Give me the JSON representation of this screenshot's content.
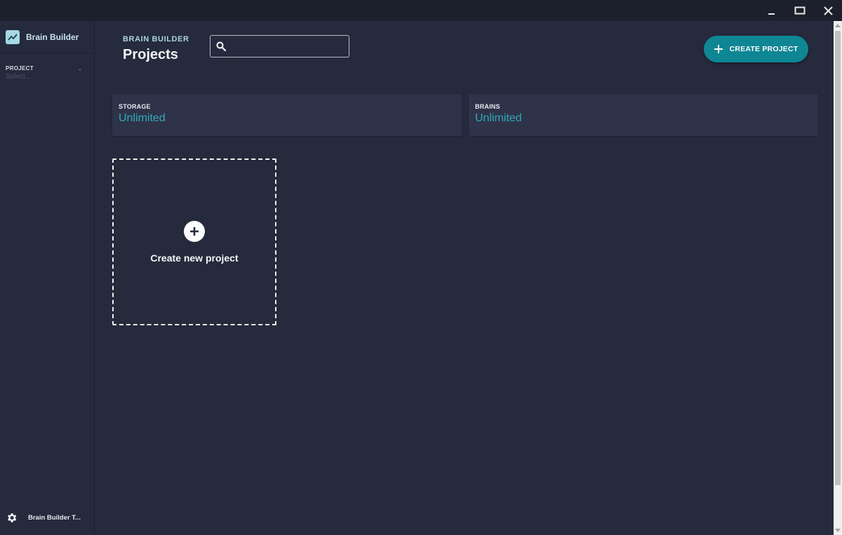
{
  "window": {
    "controls": [
      "minimize-icon",
      "maximize-icon",
      "close-icon"
    ]
  },
  "sidebar": {
    "app_name": "Brain Builder",
    "logo_icon": "trend-chart-icon",
    "project_label": "PROJECT",
    "project_placeholder": "Select...",
    "footer_label": "Brain Builder T...",
    "footer_icon": "gear-icon"
  },
  "header": {
    "eyebrow": "BRAIN BUILDER",
    "title": "Projects",
    "search_placeholder": "",
    "search_icon": "search-icon",
    "create_button_label": "CREATE PROJECT",
    "create_button_icon": "plus-icon"
  },
  "stats": [
    {
      "label": "STORAGE",
      "value": "Unlimited"
    },
    {
      "label": "BRAINS",
      "value": "Unlimited"
    }
  ],
  "new_project_tile": {
    "label": "Create new project",
    "icon": "plus-circle-icon"
  },
  "colors": {
    "background": "#262a3d",
    "titlebar": "#1c1f2c",
    "card": "#2f3349",
    "accent": "#0f8694",
    "stat_value": "#2fa9ba",
    "eyebrow": "#a9d5e2"
  }
}
